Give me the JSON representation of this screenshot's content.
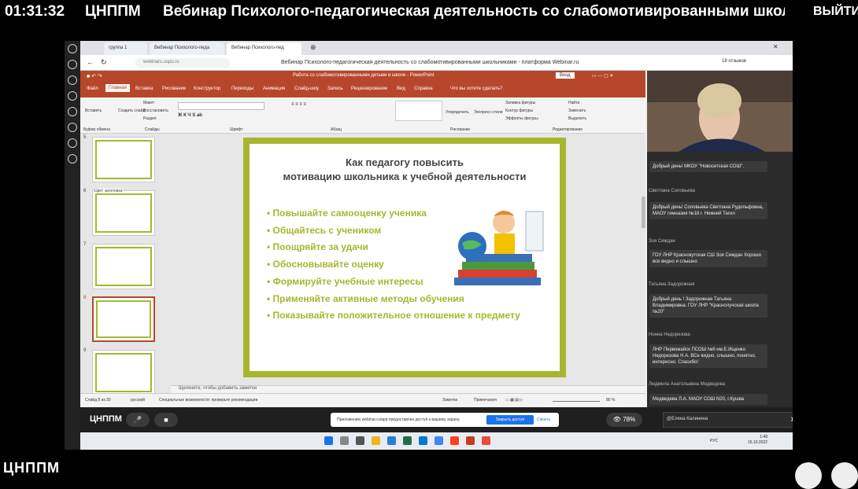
{
  "header": {
    "time": "01:31:32",
    "org": "ЦНППМ",
    "title": "Вебинар Психолого-педагогическая деятельность со слабомотивированными школьниками",
    "exit_label": "ВЫЙТИ"
  },
  "footer": {
    "logo": "ЦНППМ"
  },
  "browser": {
    "tabs": [
      "группа 1",
      "Вебинар Психолого-педа",
      "Вебинар Психолого-пед"
    ],
    "url": "webinars.uspu.ru",
    "page_title": "Вебинар Психолого-педагогическая деятельность со слабомотивированными школьниками - платформа Webinar.ru",
    "reviews": "18 отзывов"
  },
  "powerpoint": {
    "window_title": "Работа со слабомотивированными детьми в школе - PowerPoint",
    "login": "Вход",
    "tabs": [
      "Файл",
      "Главная",
      "Вставка",
      "Рисование",
      "Конструктор",
      "Переходы",
      "Анимация",
      "Слайд-шоу",
      "Запись",
      "Рецензирование",
      "Вид",
      "Справка",
      "Что вы хотите сделать?"
    ],
    "ribbon_groups": [
      "Буфер обмена",
      "Слайды",
      "Шрифт",
      "Абзац",
      "Рисование",
      "Редактирование"
    ],
    "ribbon_items": {
      "paste": "Вставить",
      "new_slide": "Создать слайд",
      "layout": "Макет",
      "reset": "Восстановить",
      "section": "Раздел",
      "arrange": "Упорядочить",
      "quick_styles": "Экспресс-стили",
      "fill": "Заливка фигуры",
      "outline": "Контур фигуры",
      "effects": "Эффекты фигуры",
      "find": "Найти",
      "replace": "Заменить",
      "select": "Выделить"
    },
    "thumbnails": [
      {
        "num": "5",
        "label": ""
      },
      {
        "num": "6",
        "label": "Цвет заголовка"
      },
      {
        "num": "7",
        "label": ""
      },
      {
        "num": "8",
        "label": ""
      },
      {
        "num": "9",
        "label": ""
      }
    ],
    "notes_placeholder": "Щелкните, чтобы добавить заметки",
    "status": {
      "slide": "Слайд 8 из 30",
      "lang": "русский",
      "accessibility": "Специальные возможности: проверьте рекомендации",
      "notes": "Заметки",
      "comments": "Примечания",
      "zoom": "80 %"
    }
  },
  "slide": {
    "title_line1": "Как педагогу повысить",
    "title_line2": "мотивацию школьника к учебной деятельности",
    "bullets": [
      "Повышайте самооценку ученика",
      "Общайтесь с учеником",
      "Поощряйте за удачи",
      "Обосновывайте оценку",
      "Формируйте учебные интересы",
      "Применяйте активные методы обучения",
      "Показывайте положительное отношение  к предмету"
    ]
  },
  "chat": {
    "messages": [
      {
        "name": "",
        "text": "Добрый день! МКОУ \"Новосетская СОШ\"."
      },
      {
        "name": "Светлана Соловьева",
        "text": "Добрый день! Соловьева Светлана Рудольфовна, МАОУ гимназия №18 г. Нижний Тагил"
      },
      {
        "name": "Зоя Сиждан",
        "text": "ГОУ ЛНР Краснокутская СШ  Зоя Сиждан Хорошо все видно и  слышно"
      },
      {
        "name": "Татьяна Задорожная",
        "text": "Добрый день ! Задорожная Татьяна Владимировна. ГОУ ЛНР \"Краснолучская школа №20\""
      },
      {
        "name": "Нонна Недорезова",
        "text": "ЛНР Первомайск ПСОШ №6 им.Е.Ищенко Недорезова Н.А. ВСе видно, слышно, понятно, интересно. Спасибо!"
      },
      {
        "name": "Людмила Анатольевна Медведева",
        "text": "Медведева Л.А.  МАОУ СОШ N20, г.Кушва"
      }
    ],
    "input_value": "@Елена Калинина"
  },
  "bottombar": {
    "logo": "ЦНППМ",
    "viewers": "78%",
    "notify_text": "Приложению webinar.ru/app предоставлен доступ к вашему экрану.",
    "notify_button": "Закрыть доступ",
    "notify_hide": "Скрыть"
  },
  "taskbar": {
    "lang": "РУС",
    "time": "1:49",
    "date": "15.10.2022"
  }
}
